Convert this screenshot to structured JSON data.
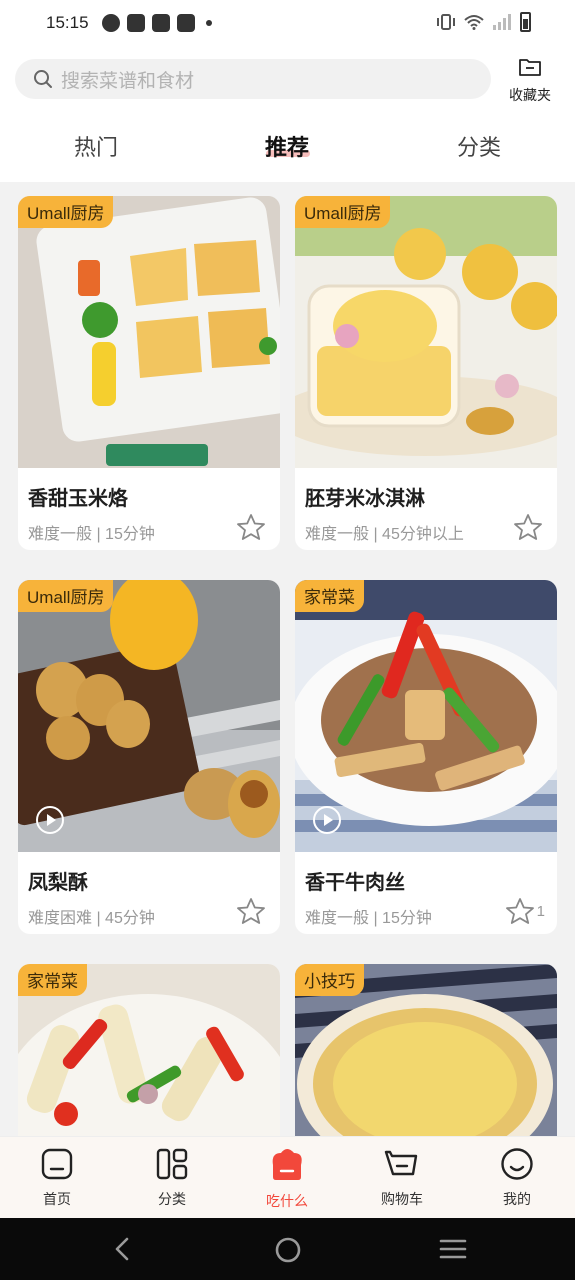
{
  "status_bar": {
    "time": "15:15"
  },
  "search": {
    "placeholder": "搜索菜谱和食材"
  },
  "favorites": {
    "label": "收藏夹"
  },
  "tabs": [
    {
      "label": "热门"
    },
    {
      "label": "推荐",
      "active": true
    },
    {
      "label": "分类"
    }
  ],
  "cards": [
    {
      "badge": "Umall厨房",
      "title": "香甜玉米烙",
      "meta": "难度一般 | 15分钟",
      "star_count": "",
      "video": false
    },
    {
      "badge": "Umall厨房",
      "title": "胚芽米冰淇淋",
      "meta": "难度一般 | 45分钟以上",
      "star_count": "",
      "video": false
    },
    {
      "badge": "Umall厨房",
      "title": "凤梨酥",
      "meta": "难度困难 | 45分钟",
      "star_count": "",
      "video": true
    },
    {
      "badge": "家常菜",
      "title": "香干牛肉丝",
      "meta": "难度一般 | 15分钟",
      "star_count": "1",
      "video": true
    },
    {
      "badge": "家常菜",
      "title": "",
      "meta": "",
      "star_count": "",
      "video": false
    },
    {
      "badge": "小技巧",
      "title": "",
      "meta": "",
      "star_count": "",
      "video": false
    }
  ],
  "bottom_nav": [
    {
      "label": "首页",
      "icon": "home-icon"
    },
    {
      "label": "分类",
      "icon": "category-icon"
    },
    {
      "label": "吃什么",
      "icon": "chef-hat-icon",
      "active": true
    },
    {
      "label": "购物车",
      "icon": "cart-icon"
    },
    {
      "label": "我的",
      "icon": "profile-icon"
    }
  ],
  "colors": {
    "accent": "#f2483b",
    "badge": "#f7b33a"
  }
}
